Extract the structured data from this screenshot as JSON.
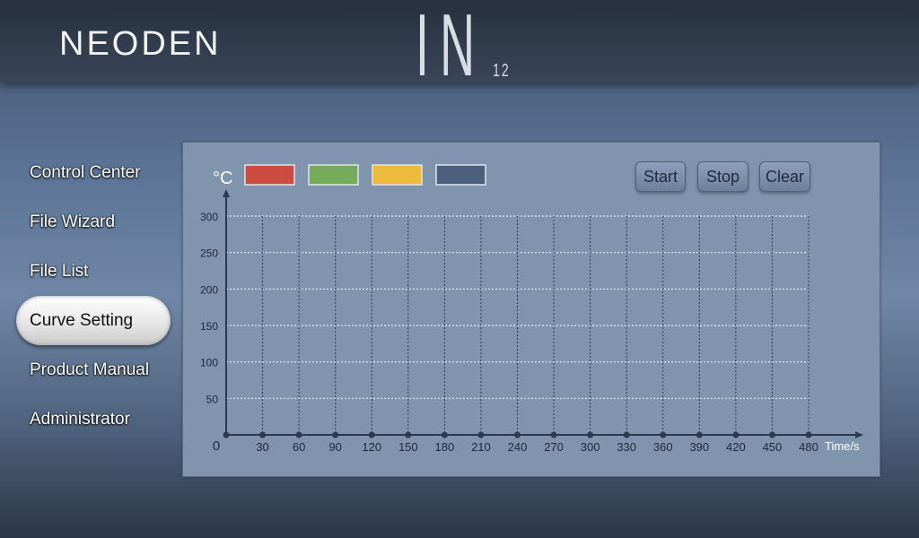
{
  "header": {
    "brand": "NEODEN",
    "model": "IN",
    "model_number": "12"
  },
  "nav": {
    "items": [
      {
        "label": "Control Center",
        "active": false
      },
      {
        "label": "File Wizard",
        "active": false
      },
      {
        "label": "File List",
        "active": false
      },
      {
        "label": "Curve Setting",
        "active": true
      },
      {
        "label": "Product Manual",
        "active": false
      },
      {
        "label": "Administrator",
        "active": false
      }
    ]
  },
  "toolbar": {
    "start": "Start",
    "stop": "Stop",
    "clear": "Clear"
  },
  "chart_data": {
    "type": "line",
    "ylabel": "°C",
    "xlabel": "Time/s",
    "origin_label": "0",
    "xlim": [
      0,
      480
    ],
    "ylim": [
      0,
      300
    ],
    "x_ticks": [
      30,
      60,
      90,
      120,
      150,
      180,
      210,
      240,
      270,
      300,
      330,
      360,
      390,
      420,
      450,
      480
    ],
    "y_ticks": [
      50,
      100,
      150,
      200,
      250,
      300
    ],
    "grid": true,
    "legend_placement": "top-left",
    "legend_colors": [
      "#cc4b43",
      "#76ab59",
      "#edb93c",
      "#4b5f7e"
    ],
    "series": []
  }
}
